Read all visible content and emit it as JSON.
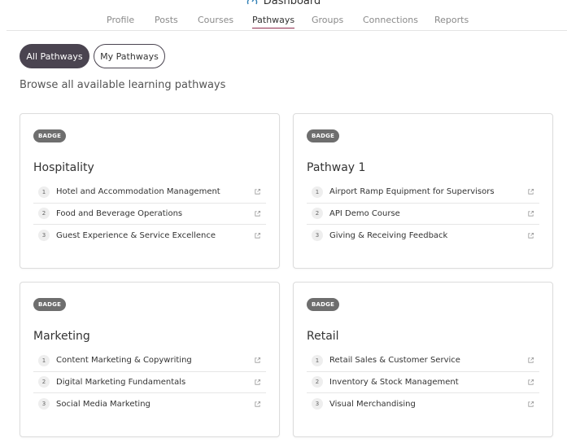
{
  "header": {
    "title": "Dashboard",
    "icon": "dashboard-gauge-icon"
  },
  "nav": {
    "items": [
      {
        "label": "Profile",
        "active": false
      },
      {
        "label": "Posts",
        "active": false
      },
      {
        "label": "Courses",
        "active": false
      },
      {
        "label": "Pathways",
        "active": true
      },
      {
        "label": "Groups",
        "active": false
      },
      {
        "label": "Connections",
        "active": false
      },
      {
        "label": "Reports",
        "active": false
      }
    ],
    "active_color": "#8e2d4e"
  },
  "filters": {
    "all_label": "All Pathways",
    "mine_label": "My Pathways",
    "selected": "All Pathways"
  },
  "browse_text": "Browse all available learning pathways",
  "pathways": [
    {
      "badge": "BADGE",
      "title": "Hospitality",
      "courses": [
        {
          "num": "1",
          "name": "Hotel and Accommodation Management"
        },
        {
          "num": "2",
          "name": "Food and Beverage Operations"
        },
        {
          "num": "3",
          "name": "Guest Experience & Service Excellence"
        }
      ]
    },
    {
      "badge": "BADGE",
      "title": "Pathway 1",
      "courses": [
        {
          "num": "1",
          "name": "Airport Ramp Equipment for Supervisors"
        },
        {
          "num": "2",
          "name": "API Demo Course"
        },
        {
          "num": "3",
          "name": "Giving & Receiving Feedback"
        }
      ]
    },
    {
      "badge": "BADGE",
      "title": "Marketing",
      "courses": [
        {
          "num": "1",
          "name": "Content Marketing & Copywriting"
        },
        {
          "num": "2",
          "name": "Digital Marketing Fundamentals"
        },
        {
          "num": "3",
          "name": "Social Media Marketing"
        }
      ]
    },
    {
      "badge": "BADGE",
      "title": "Retail",
      "courses": [
        {
          "num": "1",
          "name": "Retail Sales & Customer Service"
        },
        {
          "num": "2",
          "name": "Inventory & Stock Management"
        },
        {
          "num": "3",
          "name": "Visual Merchandising"
        }
      ]
    }
  ],
  "colors": {
    "pill_dark": "#4a4450",
    "badge": "#6e6e6e",
    "dashboard_icon": "#2f7fb5"
  }
}
